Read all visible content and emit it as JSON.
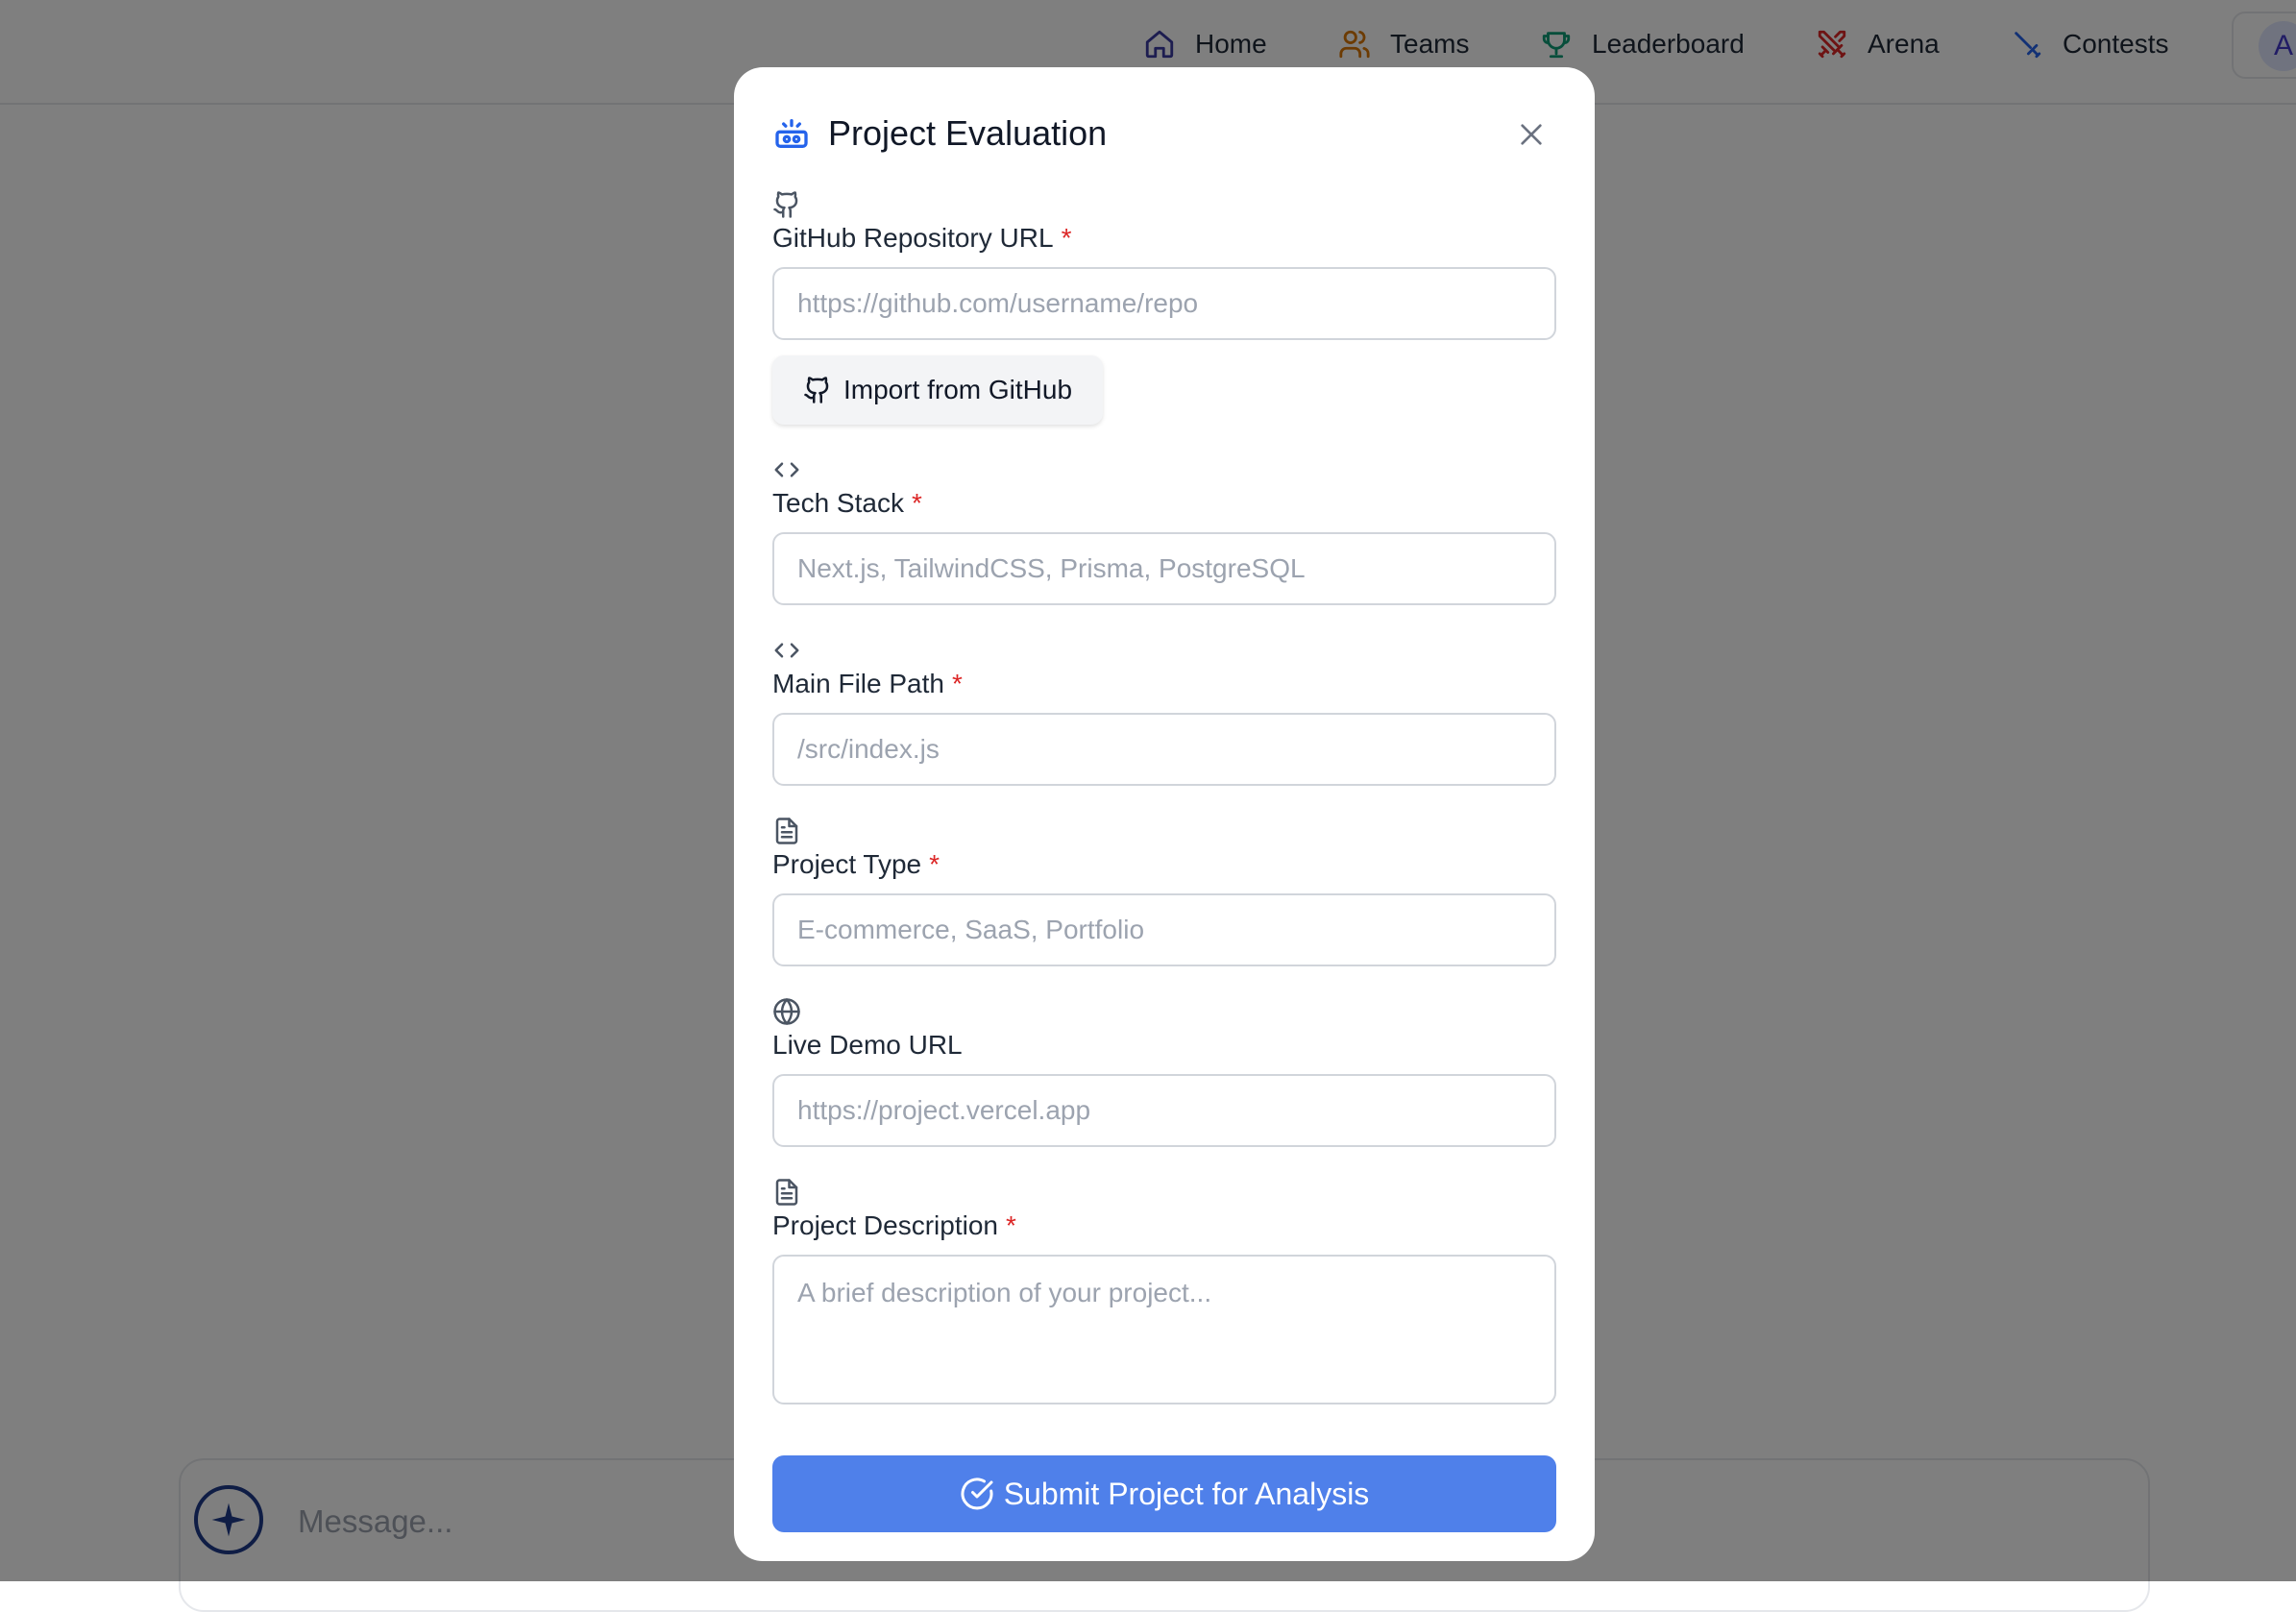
{
  "nav": {
    "items": [
      {
        "label": "Home",
        "icon": "home-icon",
        "color": "#3b3ba0"
      },
      {
        "label": "Teams",
        "icon": "users-icon",
        "color": "#d97706"
      },
      {
        "label": "Leaderboard",
        "icon": "trophy-icon",
        "color": "#0f9d76"
      },
      {
        "label": "Arena",
        "icon": "swords-icon",
        "color": "#dc2626"
      },
      {
        "label": "Contests",
        "icon": "sword-icon",
        "color": "#2563eb"
      }
    ],
    "avatar_initial": "A"
  },
  "chat": {
    "placeholder": "Message..."
  },
  "modal": {
    "title": "Project Evaluation",
    "title_icon": "robot-icon",
    "close_icon": "close-icon",
    "fields": {
      "github_url": {
        "label": "GitHub Repository URL",
        "required": "*",
        "placeholder": "https://github.com/username/repo",
        "icon": "github-icon"
      },
      "tech_stack": {
        "label": "Tech Stack",
        "required": "*",
        "placeholder": "Next.js, TailwindCSS, Prisma, PostgreSQL",
        "icon": "code-icon"
      },
      "main_file": {
        "label": "Main File Path",
        "required": "*",
        "placeholder": "/src/index.js",
        "icon": "code-icon"
      },
      "project_type": {
        "label": "Project Type",
        "required": "*",
        "placeholder": "E-commerce, SaaS, Portfolio",
        "icon": "file-text-icon"
      },
      "live_demo": {
        "label": "Live Demo URL",
        "placeholder": "https://project.vercel.app",
        "icon": "globe-icon"
      },
      "description": {
        "label": "Project Description",
        "required": "*",
        "placeholder": "A brief description of your project...",
        "icon": "file-text-icon"
      }
    },
    "import_button": "Import from GitHub",
    "submit_button": "Submit Project for Analysis"
  },
  "colors": {
    "accent": "#4f80ea",
    "required": "#dc2626",
    "overlay": "rgba(0,0,0,0.5)"
  }
}
